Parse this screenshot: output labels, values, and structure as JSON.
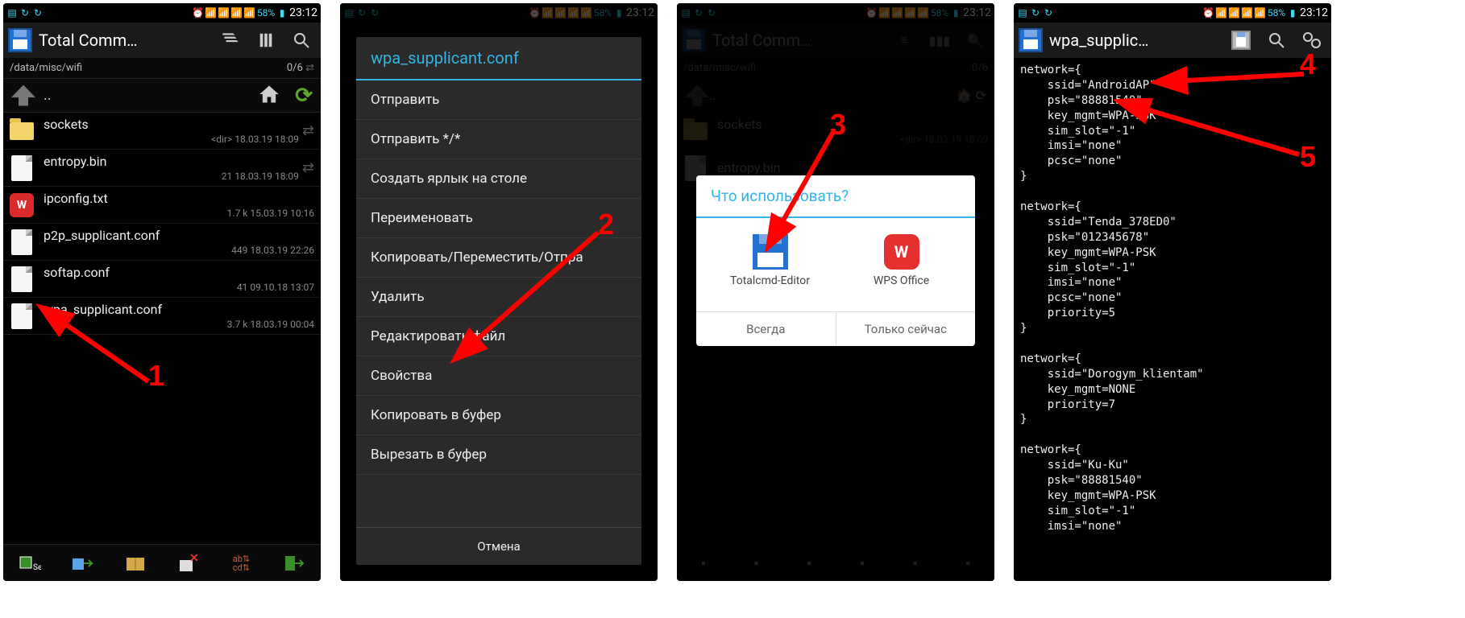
{
  "statusbar": {
    "battery": "58%",
    "time": "23:12"
  },
  "screen1": {
    "title": "Total Comm…",
    "path": "/data/misc/wifi",
    "counter": "0/6",
    "parent": "..",
    "files": [
      {
        "name": "sockets",
        "meta": "<dir>  18.03.19  18:09",
        "type": "folder"
      },
      {
        "name": "entropy.bin",
        "meta": "21  18.03.19  18:09",
        "type": "file"
      },
      {
        "name": "ipconfig.txt",
        "meta": "1.7 k  15.03.19  10:16",
        "type": "wps"
      },
      {
        "name": "p2p_supplicant.conf",
        "meta": "449  18.03.19  22:26",
        "type": "file"
      },
      {
        "name": "softap.conf",
        "meta": "41  09.10.18  13:07",
        "type": "file"
      },
      {
        "name": "wpa_supplicant.conf",
        "meta": "3.7 k  18.03.19  00:04",
        "type": "file"
      }
    ],
    "annot": "1"
  },
  "screen2": {
    "header": "wpa_supplicant.conf",
    "items": [
      "Отправить",
      "Отправить */*",
      "Создать ярлык на столе",
      "Переименовать",
      "Копировать/Переместить/Отпра",
      "Удалить",
      "Редактировать файл",
      "Свойства",
      "Копировать в буфер",
      "Вырезать в буфер"
    ],
    "cancel": "Отмена",
    "annot": "2"
  },
  "screen3": {
    "title": "Total Comm…",
    "path": "/data/misc/wifi",
    "counter": "0/6",
    "chooser_title": "Что использовать?",
    "opt1": "Totalcmd-Editor",
    "opt2": "WPS Office",
    "btn_always": "Всегда",
    "btn_once": "Только сейчас",
    "annot": "3"
  },
  "screen4": {
    "title": "wpa_supplic…",
    "content": "network={\n    ssid=\"AndroidAP\"\n    psk=\"88881540\"\n    key_mgmt=WPA-PSK\n    sim_slot=\"-1\"\n    imsi=\"none\"\n    pcsc=\"none\"\n}\n\nnetwork={\n    ssid=\"Tenda_378ED0\"\n    psk=\"012345678\"\n    key_mgmt=WPA-PSK\n    sim_slot=\"-1\"\n    imsi=\"none\"\n    pcsc=\"none\"\n    priority=5\n}\n\nnetwork={\n    ssid=\"Dorogym_klientam\"\n    key_mgmt=NONE\n    priority=7\n}\n\nnetwork={\n    ssid=\"Ku-Ku\"\n    psk=\"88881540\"\n    key_mgmt=WPA-PSK\n    sim_slot=\"-1\"\n    imsi=\"none\"",
    "annot4": "4",
    "annot5": "5"
  }
}
